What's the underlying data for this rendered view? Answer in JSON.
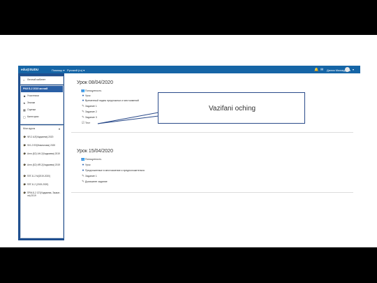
{
  "navbar": {
    "brand": "edu@SUDU",
    "menu_help": "Помощь ▾",
    "menu_lang": "Русский (ru) ▾",
    "user_name": "Дилия Махмудова"
  },
  "sidebar": {
    "items": [
      {
        "label": "Личный кабинет",
        "icon": "dashboard-icon"
      },
      {
        "label": "РКИ Б-2 2019 англий",
        "active": true
      },
      {
        "label": "Участники",
        "icon": "users-icon"
      },
      {
        "label": "Значки",
        "icon": "badge-icon"
      },
      {
        "label": "Оценки",
        "icon": "grades-icon"
      },
      {
        "label": "Категории",
        "icon": "folder-icon"
      }
    ],
    "my_courses_label": "Мои курсы",
    "courses": [
      "ФЛ-2 АЛ(Хаджиева) 2020",
      "Ф.Б-2 ЕЛ(Мавлонова) 2020",
      "Англ.(Б2) АН-2(Хаджиева) 2019",
      "Англ.(Б2) ИЯ-2(Хаджиева) 2019",
      "ПЛГ-Б-2 М(2019-2020)",
      "ПЛГ-Б-2 (2019-2020)",
      "ПРМ-Б-2 СП(Хаджиева, Эшмат-ля) 2019"
    ]
  },
  "sections": [
    {
      "title": "Урок 08/04/2020",
      "activities": [
        {
          "icon": "forum-icon",
          "label": "Пoноцреность"
        },
        {
          "icon": "url-icon",
          "label": "Урок"
        },
        {
          "icon": "url-icon",
          "label": "Временный падеж предложных и местоимений"
        },
        {
          "icon": "task-icon",
          "label": "Задание 1"
        },
        {
          "icon": "task-icon",
          "label": "Задание 2"
        },
        {
          "icon": "task-icon",
          "label": "Задание 3"
        },
        {
          "icon": "quiz-icon",
          "label": "Тест"
        }
      ]
    },
    {
      "title": "Урок 15/04/2020",
      "activities": [
        {
          "icon": "forum-icon",
          "label": "Пoноцреность"
        },
        {
          "icon": "url-icon",
          "label": "Урок"
        },
        {
          "icon": "url-icon",
          "label": "Предложенные в местоимение и предположительно"
        },
        {
          "icon": "task-icon",
          "label": "Задание 1"
        },
        {
          "icon": "task-icon",
          "label": "Домашнее задание"
        }
      ]
    }
  ],
  "callout": {
    "text": "Vazifani oching"
  }
}
